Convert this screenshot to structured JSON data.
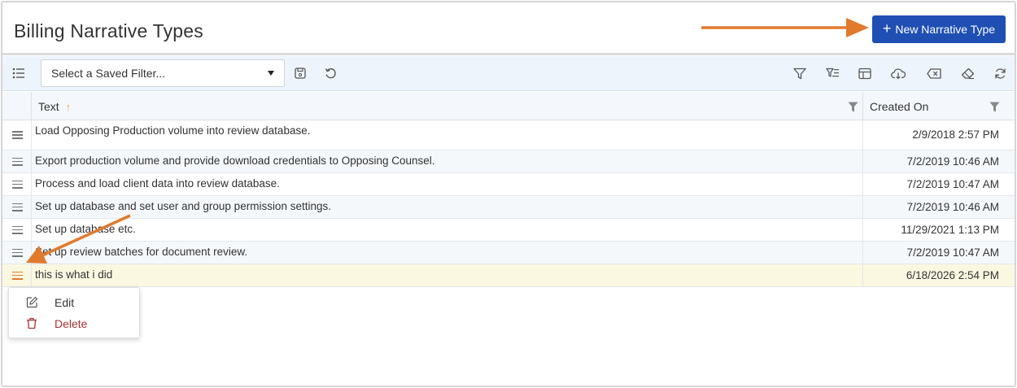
{
  "header": {
    "title": "Billing Narrative Types",
    "new_button_label": "New Narrative Type"
  },
  "toolbar": {
    "saved_filter_placeholder": "Select a Saved Filter...",
    "icons": [
      "columns-menu-icon",
      "save-icon",
      "reset-icon",
      "filter-icon",
      "filter-list-icon",
      "layout-icon",
      "cloud-download-icon",
      "clear-icon",
      "eraser-icon",
      "refresh-icon"
    ]
  },
  "grid": {
    "columns": [
      {
        "label": "Text",
        "sort": "ascending"
      },
      {
        "label": "Created On"
      }
    ],
    "rows": [
      {
        "text": "Load Opposing Production volume into review database.",
        "created_on": "2/9/2018 2:57 PM"
      },
      {
        "text": "Export production volume and provide download credentials to Opposing Counsel.",
        "created_on": "7/2/2019 10:46 AM"
      },
      {
        "text": "Process and load client data into review database.",
        "created_on": "7/2/2019 10:47 AM"
      },
      {
        "text": "Set up database and set user and group permission settings.",
        "created_on": "7/2/2019 10:46 AM"
      },
      {
        "text": "Set up database etc.",
        "created_on": "11/29/2021 1:13 PM"
      },
      {
        "text": "Set up review batches for document review.",
        "created_on": "7/2/2019 10:47 AM"
      },
      {
        "text": "this is what i did",
        "created_on": "6/18/2026 2:54 PM"
      }
    ]
  },
  "context_menu": {
    "edit_label": "Edit",
    "delete_label": "Delete"
  },
  "colors": {
    "primary_button": "#1f4fb3",
    "annotation_arrow": "#e27a2e",
    "delete_text": "#a83232",
    "selected_row": "#fbf8e2"
  }
}
